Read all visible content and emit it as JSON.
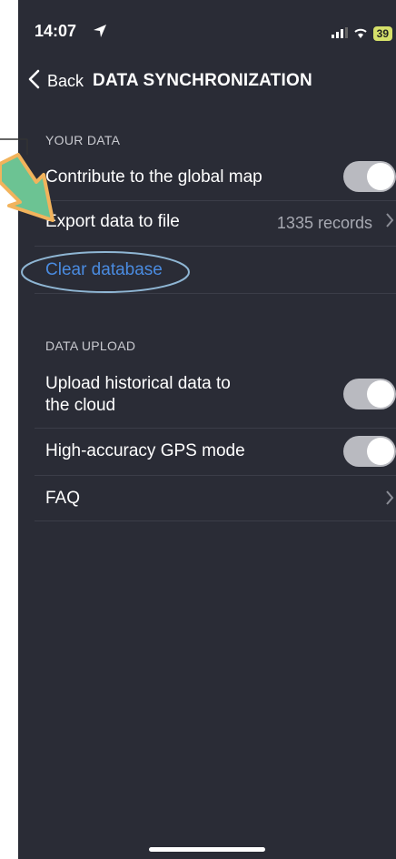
{
  "status_bar": {
    "time": "14:07",
    "battery": "39"
  },
  "nav": {
    "back_label": "Back",
    "title": "DATA SYNCHRONIZATION"
  },
  "sections": [
    {
      "header": "YOUR DATA",
      "rows": [
        {
          "label": "Contribute to the global map",
          "control": "toggle",
          "on": true
        },
        {
          "label": "Export data to file",
          "value": "1335 records",
          "control": "chevron"
        },
        {
          "label": "Clear database",
          "control": "link"
        }
      ]
    },
    {
      "header": "DATA UPLOAD",
      "rows": [
        {
          "label_line1": "Upload historical data to",
          "label_line2": "the cloud",
          "control": "toggle",
          "on": true
        },
        {
          "label": "High-accuracy GPS mode",
          "control": "toggle",
          "on": true
        },
        {
          "label": "FAQ",
          "control": "chevron"
        }
      ]
    }
  ],
  "colors": {
    "background": "#2a2c36",
    "link": "#4a8be0",
    "annotation_arrow": "#6cc393",
    "annotation_ellipse": "#8fb6d4"
  },
  "icons": [
    "location-arrow-icon",
    "signal-icon",
    "wifi-icon",
    "battery-icon",
    "chevron-left-icon",
    "chevron-right-icon"
  ]
}
